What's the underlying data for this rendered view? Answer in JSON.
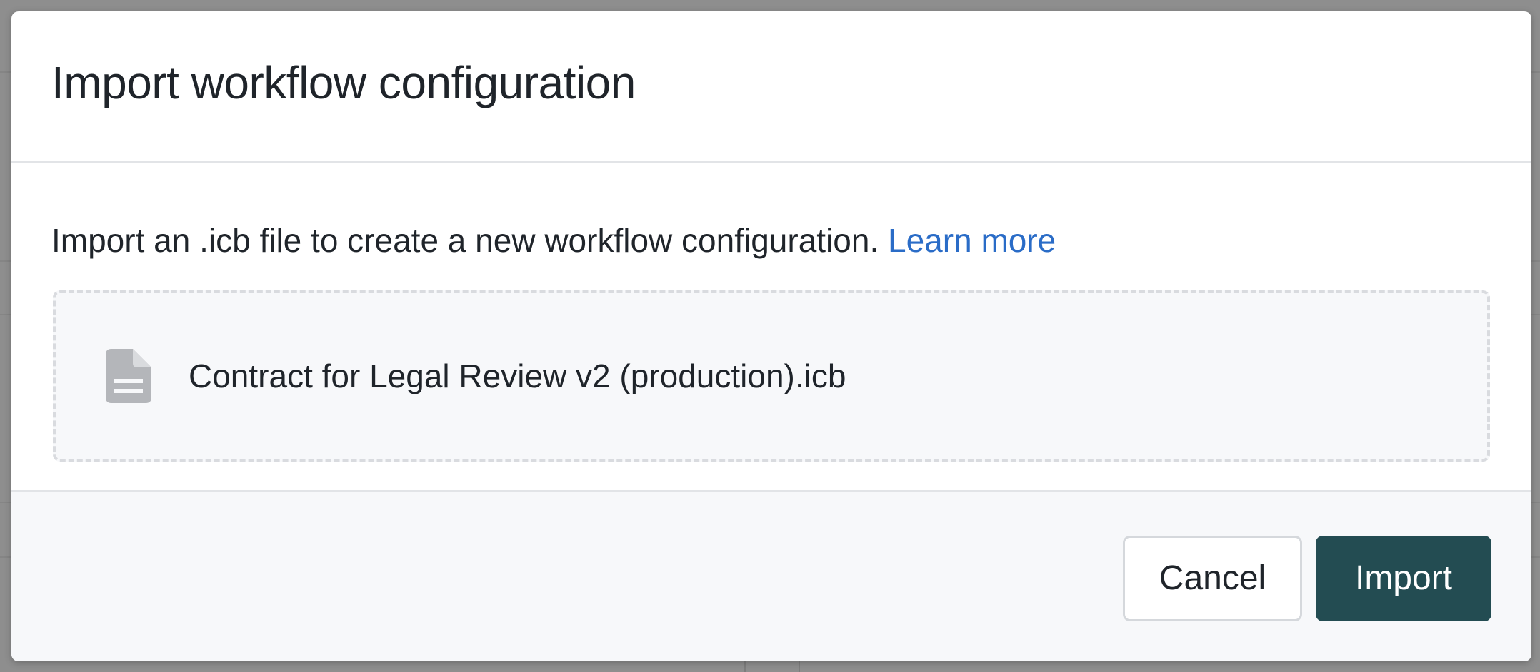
{
  "modal": {
    "title": "Import workflow configuration",
    "description": "Import an .icb file to create a new workflow configuration.",
    "learn_more_label": "Learn more",
    "file": {
      "name": "Contract for Legal Review v2 (production).icb",
      "icon": "document-icon"
    },
    "buttons": {
      "cancel_label": "Cancel",
      "import_label": "Import"
    }
  },
  "colors": {
    "primary_button": "#234c52",
    "link": "#2a6cc7",
    "text": "#1f242a",
    "backdrop": "#8e8e8e"
  }
}
